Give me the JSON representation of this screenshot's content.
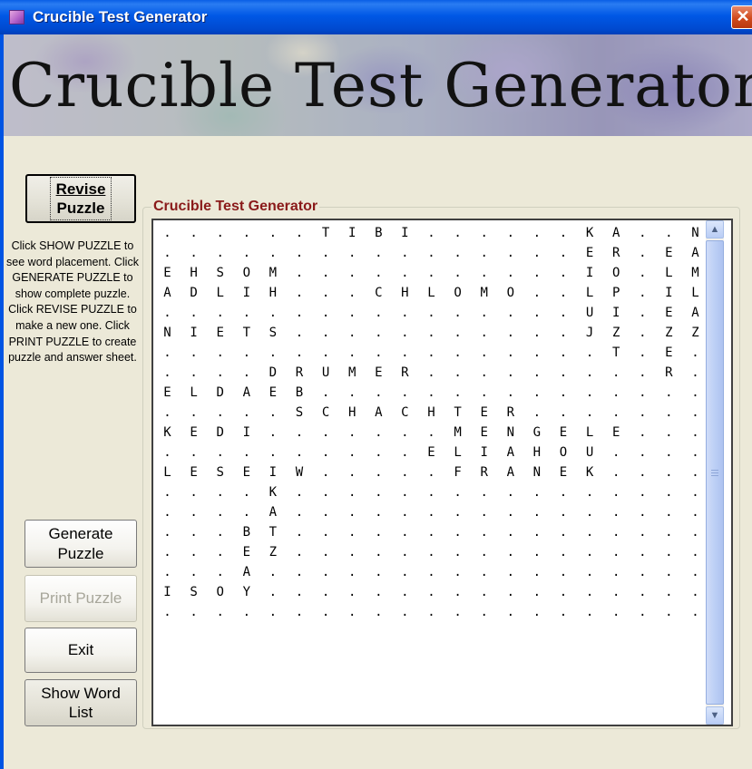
{
  "window": {
    "title": "Crucible Test Generator",
    "close_label": "✕"
  },
  "banner": {
    "text": "Crucible Test Generator"
  },
  "buttons": {
    "revise": {
      "line1": "Revise",
      "line2": "Puzzle"
    },
    "generate": {
      "line1": "Generate",
      "line2": "Puzzle"
    },
    "print": {
      "label": "Print Puzzle"
    },
    "exit": {
      "label": "Exit"
    },
    "show_word_list": {
      "line1": "Show Word",
      "line2": "List"
    }
  },
  "instructions": "Click SHOW PUZZLE to see word placement. Click GENERATE PUZZLE to show complete puzzle. Click REVISE PUZZLE to make a new one. Click PRINT PUZZLE to create puzzle and answer sheet.",
  "puzzle": {
    "label": "Crucible Test Generator",
    "rows": [
      ". . . . . . T I B I . . . . . . K A . . N",
      ". . . . . . . . . . . . . . . . E R . E A",
      "E H S O M . . . . . . . . . . . I O . L M",
      "A D L I H . . . C H L O M O . . L P . I L",
      ". . . . . . . . . . . . . . . . U I . E A",
      "N I E T S . . . . . . . . . . . J Z . Z Z",
      ". . . . . . . . . . . . . . . . . T . E .",
      ". . . . D R U M E R . . . . . . . . . R .",
      "E L D A E B . . . . . . . . . . . . . . .",
      ". . . . . S C H A C H T E R . . . . . . .",
      "K E D I . . . . . . . M E N G E L E . . .",
      ". . . . . . . . . . E L I A H O U . . . .",
      "L E S E I W . . . . . F R A N E K . . . .",
      ". . . . K . . . . . . . . . . . . . . . .",
      ". . . . A . . . . . . . . . . . . . . . .",
      ". . . B T . . . . . . . . . . . . . . . .",
      ". . . E Z . . . . . . . . . . . . . . . .",
      ". . . A . . . . . . . . . . . . . . . . .",
      "I S O Y . . . . . . . . . . . . . . . . .",
      ". . . . . . . . . . . . . . . . . . . . ."
    ]
  }
}
